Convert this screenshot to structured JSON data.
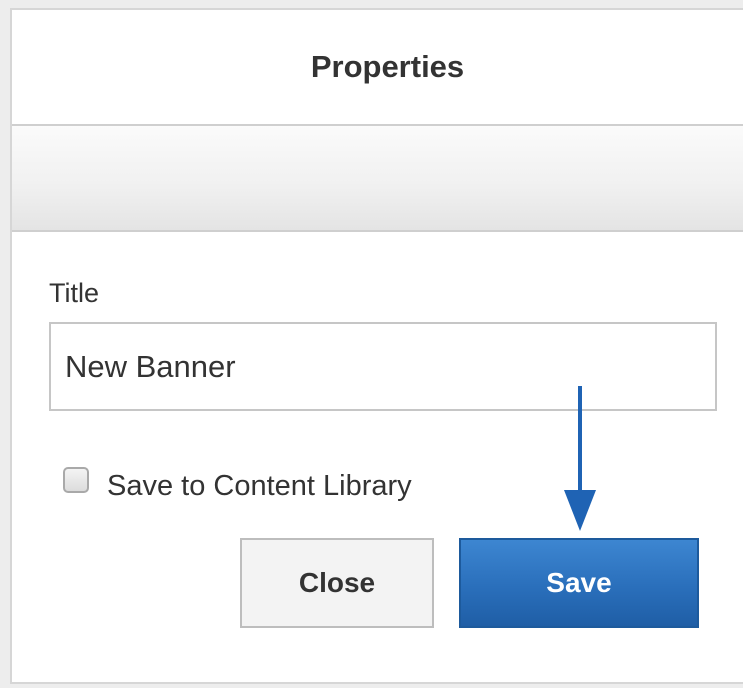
{
  "dialog": {
    "title": "Properties"
  },
  "form": {
    "title_label": "Title",
    "title_value": "New Banner",
    "save_to_library_label": "Save to Content Library",
    "save_to_library_checked": false
  },
  "buttons": {
    "close_label": "Close",
    "save_label": "Save"
  },
  "colors": {
    "save_button": "#2a6fbb",
    "annotation_arrow": "#1f63b4"
  },
  "icons": {
    "annotation": "arrow-down-icon"
  }
}
